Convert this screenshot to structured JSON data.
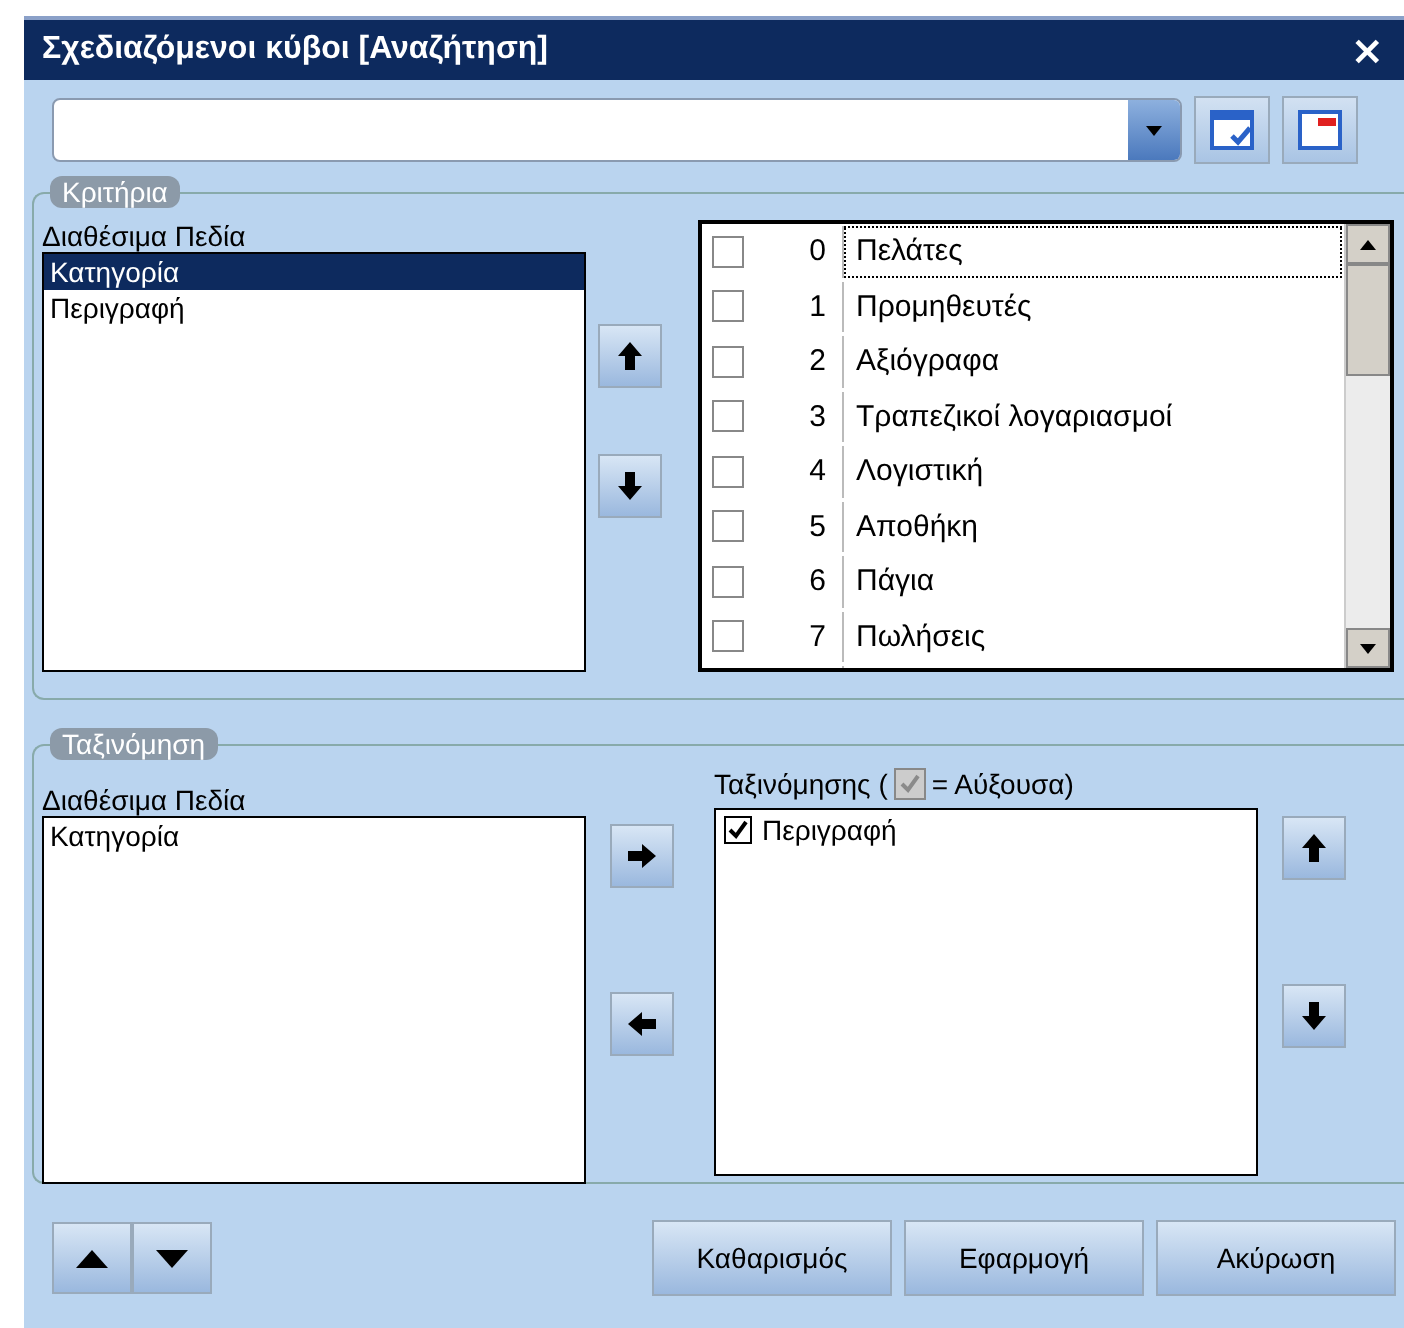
{
  "window": {
    "title": "Σχεδιαζόμενοι κύβοι [Αναζήτηση]",
    "close": "×"
  },
  "criteria": {
    "title": "Κριτήρια",
    "available_label": "Διαθέσιμα Πεδία",
    "available": [
      {
        "label": "Κατηγορία",
        "selected": true
      },
      {
        "label": "Περιγραφή",
        "selected": false
      }
    ],
    "rows": [
      {
        "index": "0",
        "label": "Πελάτες",
        "checked": false,
        "focused": true
      },
      {
        "index": "1",
        "label": "Προμηθευτές",
        "checked": false,
        "focused": false
      },
      {
        "index": "2",
        "label": "Αξιόγραφα",
        "checked": false,
        "focused": false
      },
      {
        "index": "3",
        "label": "Τραπεζικοί λογαριασμοί",
        "checked": false,
        "focused": false
      },
      {
        "index": "4",
        "label": "Λογιστική",
        "checked": false,
        "focused": false
      },
      {
        "index": "5",
        "label": "Αποθήκη",
        "checked": false,
        "focused": false
      },
      {
        "index": "6",
        "label": "Πάγια",
        "checked": false,
        "focused": false
      },
      {
        "index": "7",
        "label": "Πωλήσεις",
        "checked": false,
        "focused": false
      }
    ]
  },
  "sorting": {
    "title": "Ταξινόμηση",
    "available_label": "Διαθέσιμα Πεδία",
    "sorted_label_prefix": "Ταξινόμησης (",
    "sorted_label_suffix": "= Αύξουσα)",
    "available": [
      {
        "label": "Κατηγορία",
        "selected": false
      }
    ],
    "sorted": [
      {
        "label": "Περιγραφή",
        "checked": true
      }
    ]
  },
  "buttons": [
    {
      "label": "Καθαρισμός"
    },
    {
      "label": "Εφαρμογή"
    },
    {
      "label": "Ακύρωση"
    }
  ]
}
